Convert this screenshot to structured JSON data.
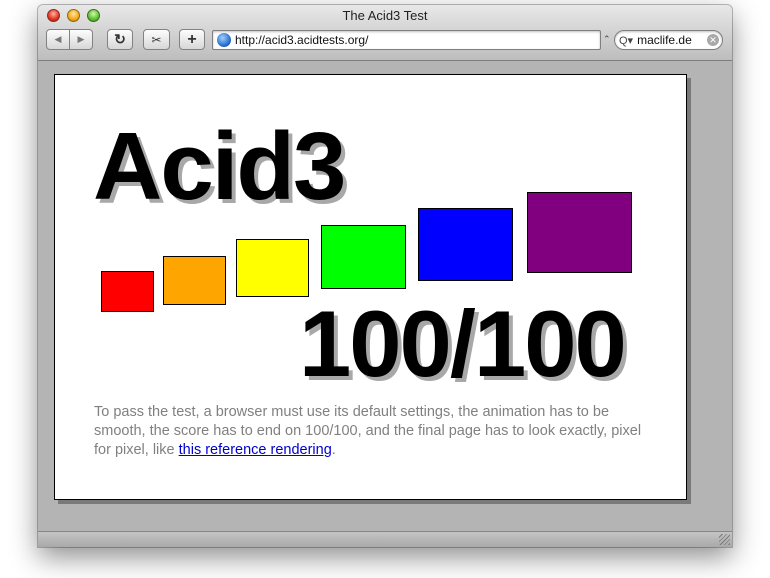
{
  "window": {
    "title": "The Acid3 Test"
  },
  "toolbar": {
    "back_icon": "◀",
    "forward_icon": "▶",
    "reload_icon": "↻",
    "snip_icon": "✂",
    "add_icon": "+",
    "url": "http://acid3.acidtests.org/",
    "search_value": "maclife.de",
    "search_icon": "Q▾",
    "clear_icon": "✕",
    "url_caret": "⌃"
  },
  "page": {
    "title": "Acid3",
    "score": "100/100",
    "description_before_link": "To pass the test, a browser must use its default settings, the animation has to be smooth, the score has to end on 100/100, and the final page has to look exactly, pixel for pixel, like ",
    "link_text": "this reference rendering",
    "description_after_link": "."
  },
  "colors": {
    "boxes": [
      "#ff0000",
      "#ffa500",
      "#ffff00",
      "#00ff00",
      "#0000ff",
      "#800080"
    ],
    "link": "#0000cc",
    "description": "#808080"
  }
}
